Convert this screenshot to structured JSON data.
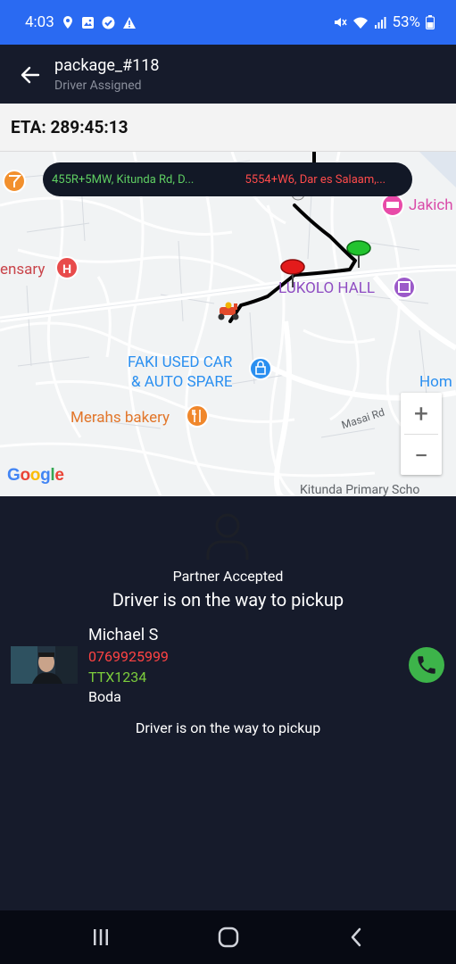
{
  "status_bar": {
    "time": "4:03",
    "battery_percent": "53%",
    "icons_left": [
      "location-pin-icon",
      "image-icon",
      "check-circle-icon",
      "warning-icon"
    ],
    "icons_right": [
      "mute-icon",
      "wifi-icon",
      "signal-icon",
      "battery-icon"
    ]
  },
  "app_bar": {
    "title": "package_#118",
    "subtitle": "Driver Assigned",
    "back_icon": "arrow-left-icon"
  },
  "eta": {
    "label": "ETA: 289:45:13"
  },
  "map": {
    "origin_address": "455R+5MW, Kitunda Rd, D...",
    "destination_address": "5554+W6, Dar es Salaam,...",
    "places": {
      "jakich": "Jakich",
      "dispensary": "ensary",
      "lukolo_hall": "LUKOLO HALL",
      "faki_line1": "FAKI USED CAR",
      "faki_line2": "& AUTO SPARE",
      "home": "Hom",
      "merahs": "Merahs bakery",
      "masai_rd": "Masai Rd",
      "kitunda_school": "Kitunda Primary Scho"
    },
    "logo": "Google",
    "zoom_in": "+",
    "zoom_out": "−",
    "colors": {
      "origin_text": "#5fcf62",
      "destination_text": "#ff4b4b",
      "route": "#000000",
      "origin_marker": "#22c32e",
      "destination_marker": "#e31b1b"
    }
  },
  "panel": {
    "partner_status": "Partner Accepted",
    "driver_status": "Driver is on the way to pickup",
    "driver": {
      "name": "Michael S",
      "phone": "0769925999",
      "plate": "TTX1234",
      "vehicle": "Boda"
    },
    "status_footer": "Driver is on the way to pickup",
    "colors": {
      "phone": "#ff4343",
      "plate": "#7ccd3c",
      "call_button": "#3db44a"
    }
  },
  "nav_bar": {
    "recents_icon": "recents-icon",
    "home_icon": "home-icon",
    "back_icon": "back-chevron-icon"
  }
}
